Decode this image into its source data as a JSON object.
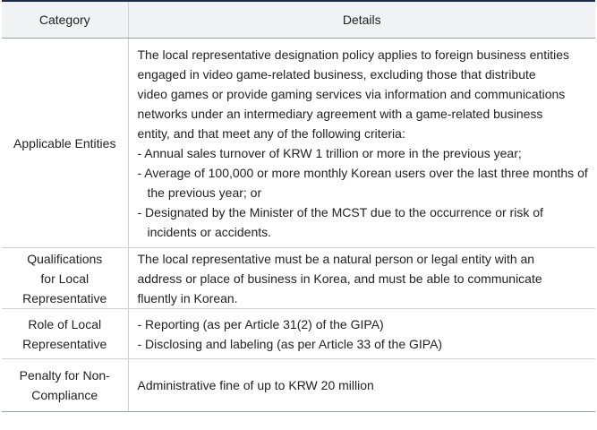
{
  "header": {
    "category": "Category",
    "details": "Details"
  },
  "rows": [
    {
      "category": [
        "Applicable Entities"
      ],
      "lines": [
        "The local representative designation policy applies to foreign business entities",
        "engaged in video game-related business, excluding those that distribute",
        "video games or provide gaming services via information and communications",
        "networks under an intermediary agreement with a game-related business",
        "entity, and that meet any of the following criteria:"
      ],
      "bullets": [
        "- Annual sales turnover of KRW 1 trillion or more in the previous year;",
        "- Average of 100,000 or more monthly Korean users over the last three months of the previous year; or",
        "- Designated by the Minister of the MCST due to the occurrence or risk of incidents or accidents."
      ]
    },
    {
      "category": [
        "Qualifications",
        "for Local",
        "Representative"
      ],
      "lines": [
        "The local representative must be a natural person or legal entity with an",
        "address or place of business in Korea, and must be able to communicate",
        "fluently in Korean."
      ],
      "bullets": []
    },
    {
      "category": [
        "Role of Local",
        "Representative"
      ],
      "lines": [],
      "bullets": [
        "- Reporting (as per Article 31(2) of the GIPA)",
        "- Disclosing and labeling (as per Article 33 of the GIPA)"
      ]
    },
    {
      "category": [
        "Penalty for Non-",
        "Compliance"
      ],
      "lines": [
        "Administrative fine of up to KRW 20 million"
      ],
      "bullets": []
    }
  ]
}
